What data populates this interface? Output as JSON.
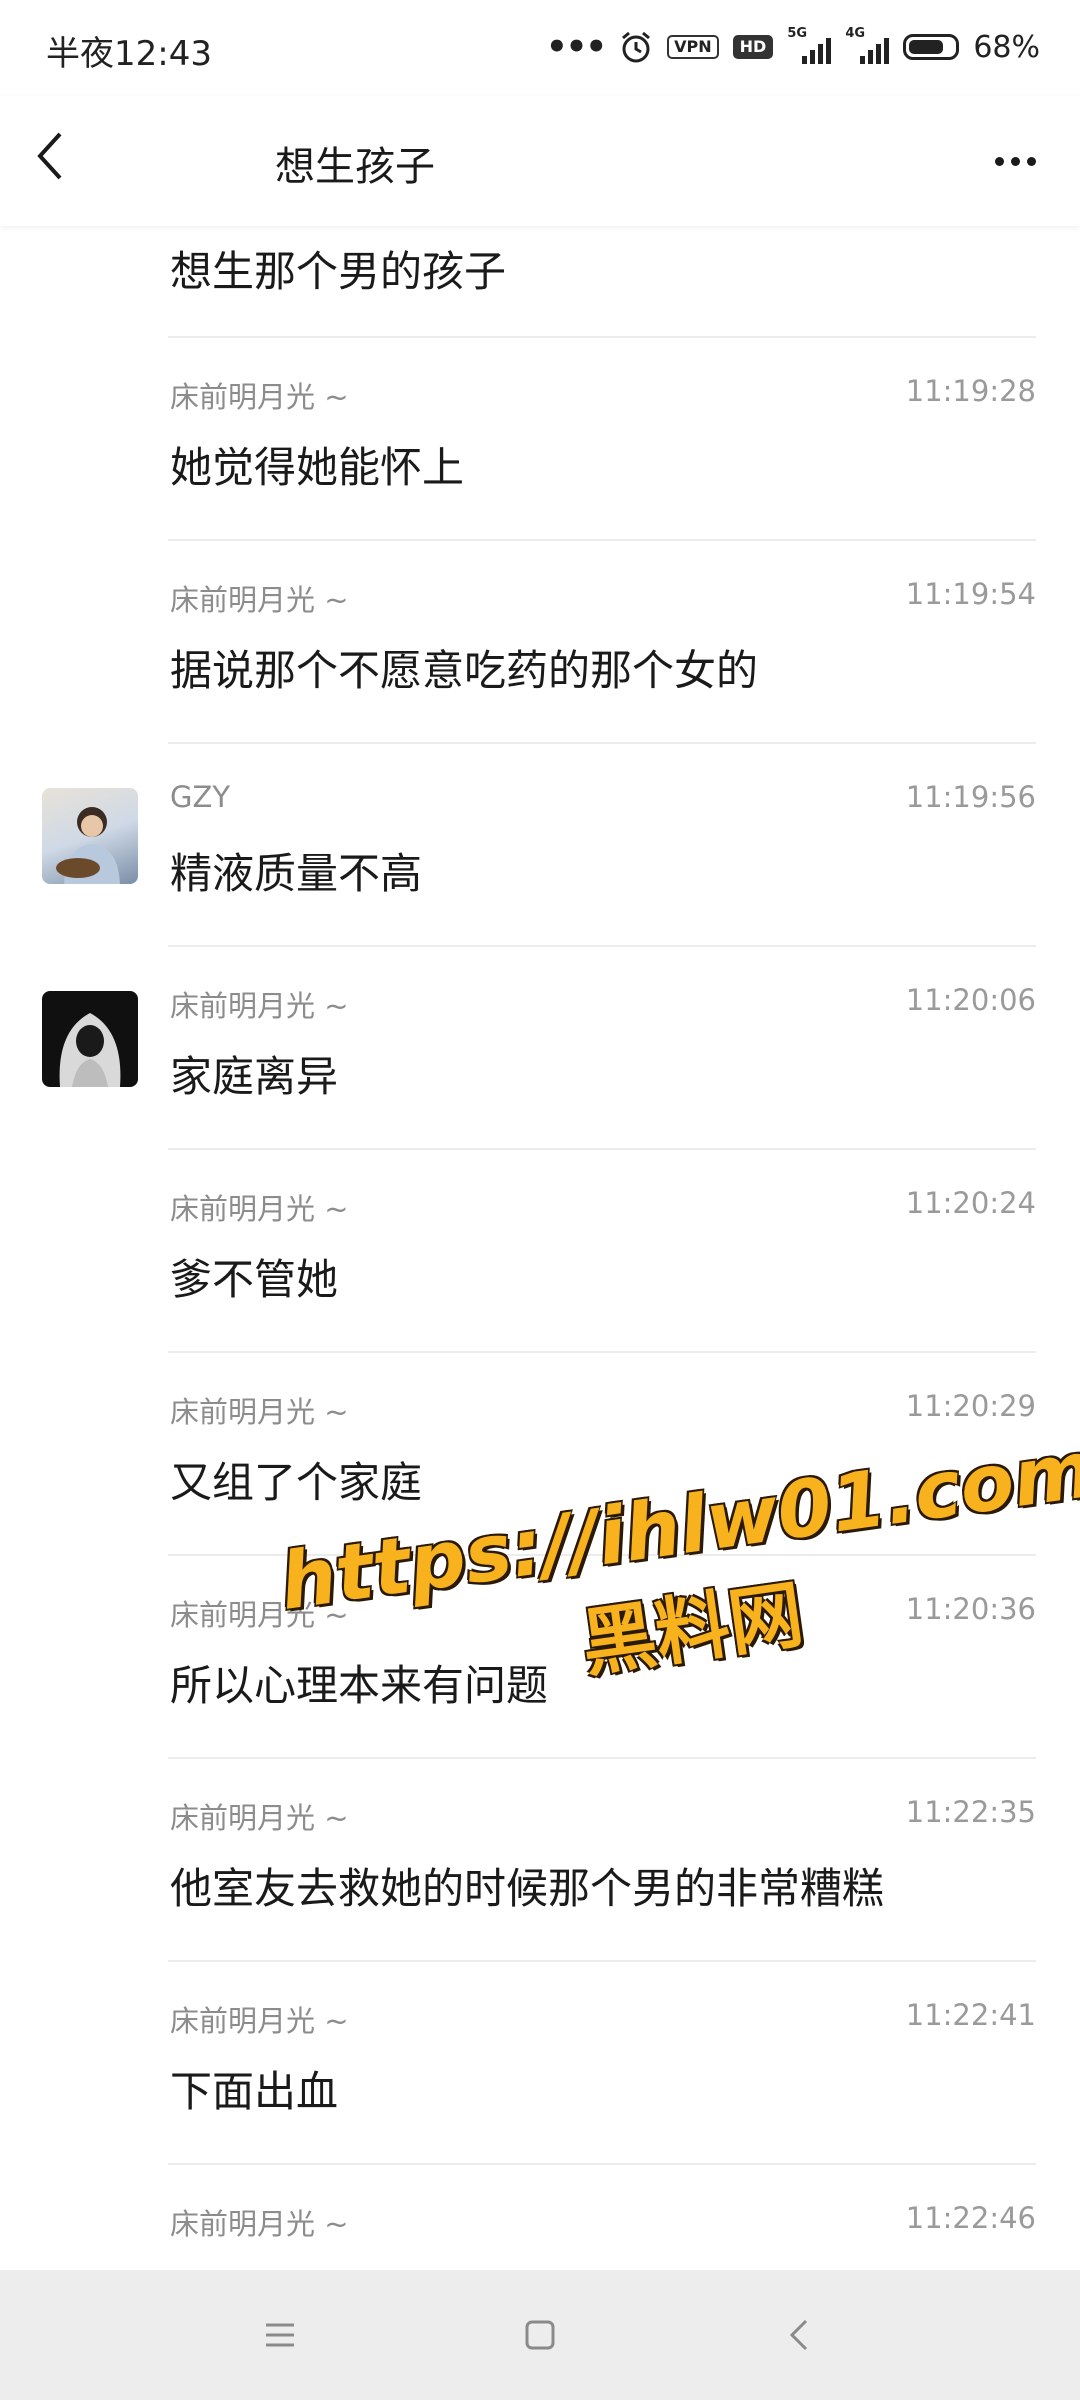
{
  "status": {
    "time": "半夜12:43",
    "vpn": "VPN",
    "hd": "HD",
    "sim1": "5G",
    "sim2": "4G",
    "battery": "68%"
  },
  "header": {
    "title": "想生孩子"
  },
  "first_message": "想生那个男的孩子",
  "messages": [
    {
      "name": "床前明月光 ~",
      "time": "11:19:28",
      "text": "她觉得她能怀上",
      "avatar": null
    },
    {
      "name": "床前明月光 ~",
      "time": "11:19:54",
      "text": "据说那个不愿意吃药的那个女的",
      "avatar": null
    },
    {
      "name": "GZY",
      "time": "11:19:56",
      "text": "精液质量不高",
      "avatar": "avatar-gzy"
    },
    {
      "name": "床前明月光 ~",
      "time": "11:20:06",
      "text": "家庭离异",
      "avatar": "avatar-hooded"
    },
    {
      "name": "床前明月光 ~",
      "time": "11:20:24",
      "text": "爹不管她",
      "avatar": null
    },
    {
      "name": "床前明月光 ~",
      "time": "11:20:29",
      "text": "又组了个家庭",
      "avatar": null
    },
    {
      "name": "床前明月光 ~",
      "time": "11:20:36",
      "text": "所以心理本来有问题",
      "avatar": null
    },
    {
      "name": "床前明月光 ~",
      "time": "11:22:35",
      "text": "他室友去救她的时候那个男的非常糟糕",
      "avatar": null
    },
    {
      "name": "床前明月光 ~",
      "time": "11:22:41",
      "text": "下面出血",
      "avatar": null
    },
    {
      "name": "床前明月光 ~",
      "time": "11:22:46",
      "text": "",
      "avatar": null
    }
  ],
  "watermark": {
    "url": "https://ihlw01.com",
    "site": "黑料网"
  },
  "navbar": {
    "icons": [
      "menu-icon",
      "home-icon",
      "back-icon"
    ]
  },
  "colors": {
    "name": "#8c8c8c",
    "time": "#9a9a9a",
    "divider": "#ececec",
    "navbar_bg": "#ededed",
    "watermark": "#f7b21e"
  }
}
